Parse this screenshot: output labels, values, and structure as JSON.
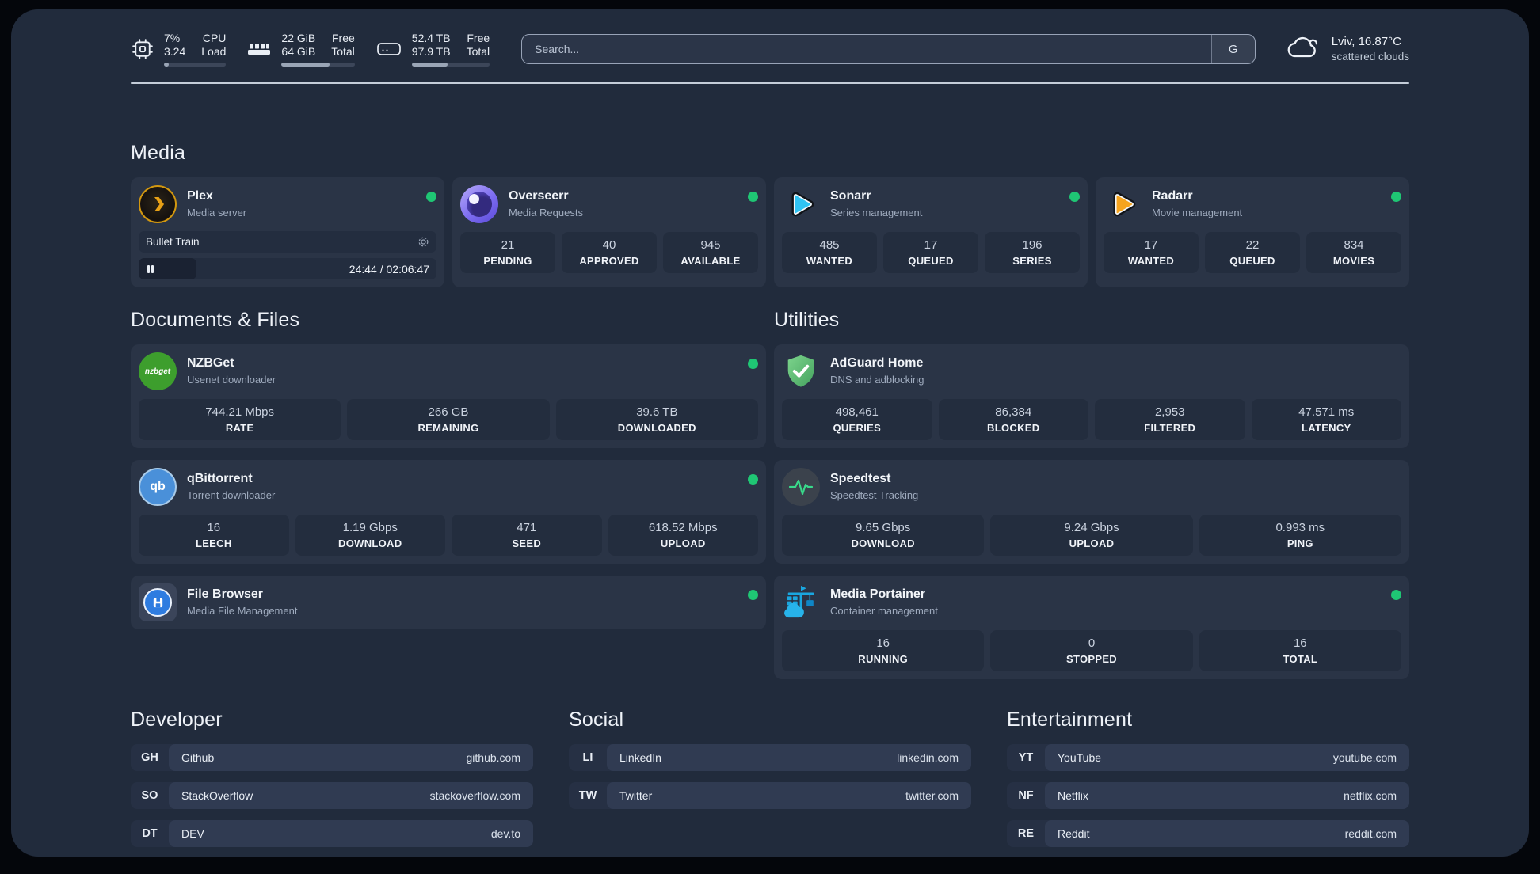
{
  "colors": {
    "page_bg": "#212b3c",
    "card_bg": "#2a3446",
    "status_online": "#1fc674",
    "plex_accent": "#e5a00d",
    "sonarr_accent": "#30c3f3",
    "radarr_accent": "#f6a41f",
    "adguard_accent": "#5fbe70",
    "portainer_accent": "#1aa7e0",
    "qbittorrent_accent": "#4a90d9",
    "nzbget_accent": "#3d9e2d",
    "speedtest_accent": "#39d98a"
  },
  "header": {
    "system": [
      {
        "value1": "7%",
        "value2": "3.24",
        "label1": "CPU",
        "label2": "Load",
        "progress": 8
      },
      {
        "value1": "22 GiB",
        "value2": "64 GiB",
        "label1": "Free",
        "label2": "Total",
        "progress": 66
      },
      {
        "value1": "52.4 TB",
        "value2": "97.9 TB",
        "label1": "Free",
        "label2": "Total",
        "progress": 46
      }
    ],
    "search": {
      "placeholder": "Search...",
      "engine_label": "G"
    },
    "weather": {
      "location_temp": "Lviv, 16.87°C",
      "condition": "scattered clouds"
    }
  },
  "icons": {
    "nzbget_label": "nzbget",
    "qbittorrent_label": "qb"
  },
  "media": {
    "title": "Media",
    "plex": {
      "name": "Plex",
      "desc": "Media server",
      "now_playing": "Bullet Train",
      "time": "24:44 / 02:06:47",
      "progress": 19.5
    },
    "overseerr": {
      "name": "Overseerr",
      "desc": "Media Requests",
      "stats": [
        {
          "value": "21",
          "label": "PENDING"
        },
        {
          "value": "40",
          "label": "APPROVED"
        },
        {
          "value": "945",
          "label": "AVAILABLE"
        }
      ]
    },
    "sonarr": {
      "name": "Sonarr",
      "desc": "Series management",
      "stats": [
        {
          "value": "485",
          "label": "WANTED"
        },
        {
          "value": "17",
          "label": "QUEUED"
        },
        {
          "value": "196",
          "label": "SERIES"
        }
      ]
    },
    "radarr": {
      "name": "Radarr",
      "desc": "Movie management",
      "stats": [
        {
          "value": "17",
          "label": "WANTED"
        },
        {
          "value": "22",
          "label": "QUEUED"
        },
        {
          "value": "834",
          "label": "MOVIES"
        }
      ]
    }
  },
  "documents": {
    "title": "Documents & Files",
    "nzbget": {
      "name": "NZBGet",
      "desc": "Usenet downloader",
      "stats": [
        {
          "value": "744.21 Mbps",
          "label": "RATE"
        },
        {
          "value": "266 GB",
          "label": "REMAINING"
        },
        {
          "value": "39.6 TB",
          "label": "DOWNLOADED"
        }
      ]
    },
    "qbittorrent": {
      "name": "qBittorrent",
      "desc": "Torrent downloader",
      "stats": [
        {
          "value": "16",
          "label": "LEECH"
        },
        {
          "value": "1.19 Gbps",
          "label": "DOWNLOAD"
        },
        {
          "value": "471",
          "label": "SEED"
        },
        {
          "value": "618.52 Mbps",
          "label": "UPLOAD"
        }
      ]
    },
    "filebrowser": {
      "name": "File Browser",
      "desc": "Media File Management"
    }
  },
  "utilities": {
    "title": "Utilities",
    "adguard": {
      "name": "AdGuard Home",
      "desc": "DNS and adblocking",
      "stats": [
        {
          "value": "498,461",
          "label": "QUERIES"
        },
        {
          "value": "86,384",
          "label": "BLOCKED"
        },
        {
          "value": "2,953",
          "label": "FILTERED"
        },
        {
          "value": "47.571 ms",
          "label": "LATENCY"
        }
      ]
    },
    "speedtest": {
      "name": "Speedtest",
      "desc": "Speedtest Tracking",
      "stats": [
        {
          "value": "9.65 Gbps",
          "label": "DOWNLOAD"
        },
        {
          "value": "9.24 Gbps",
          "label": "UPLOAD"
        },
        {
          "value": "0.993 ms",
          "label": "PING"
        }
      ]
    },
    "portainer": {
      "name": "Media Portainer",
      "desc": "Container management",
      "stats": [
        {
          "value": "16",
          "label": "RUNNING"
        },
        {
          "value": "0",
          "label": "STOPPED"
        },
        {
          "value": "16",
          "label": "TOTAL"
        }
      ]
    }
  },
  "links": {
    "developer": {
      "title": "Developer",
      "items": [
        {
          "tag": "GH",
          "name": "Github",
          "url": "github.com"
        },
        {
          "tag": "SO",
          "name": "StackOverflow",
          "url": "stackoverflow.com"
        },
        {
          "tag": "DT",
          "name": "DEV",
          "url": "dev.to"
        }
      ]
    },
    "social": {
      "title": "Social",
      "items": [
        {
          "tag": "LI",
          "name": "LinkedIn",
          "url": "linkedin.com"
        },
        {
          "tag": "TW",
          "name": "Twitter",
          "url": "twitter.com"
        }
      ]
    },
    "entertainment": {
      "title": "Entertainment",
      "items": [
        {
          "tag": "YT",
          "name": "YouTube",
          "url": "youtube.com"
        },
        {
          "tag": "NF",
          "name": "Netflix",
          "url": "netflix.com"
        },
        {
          "tag": "RE",
          "name": "Reddit",
          "url": "reddit.com"
        }
      ]
    }
  }
}
